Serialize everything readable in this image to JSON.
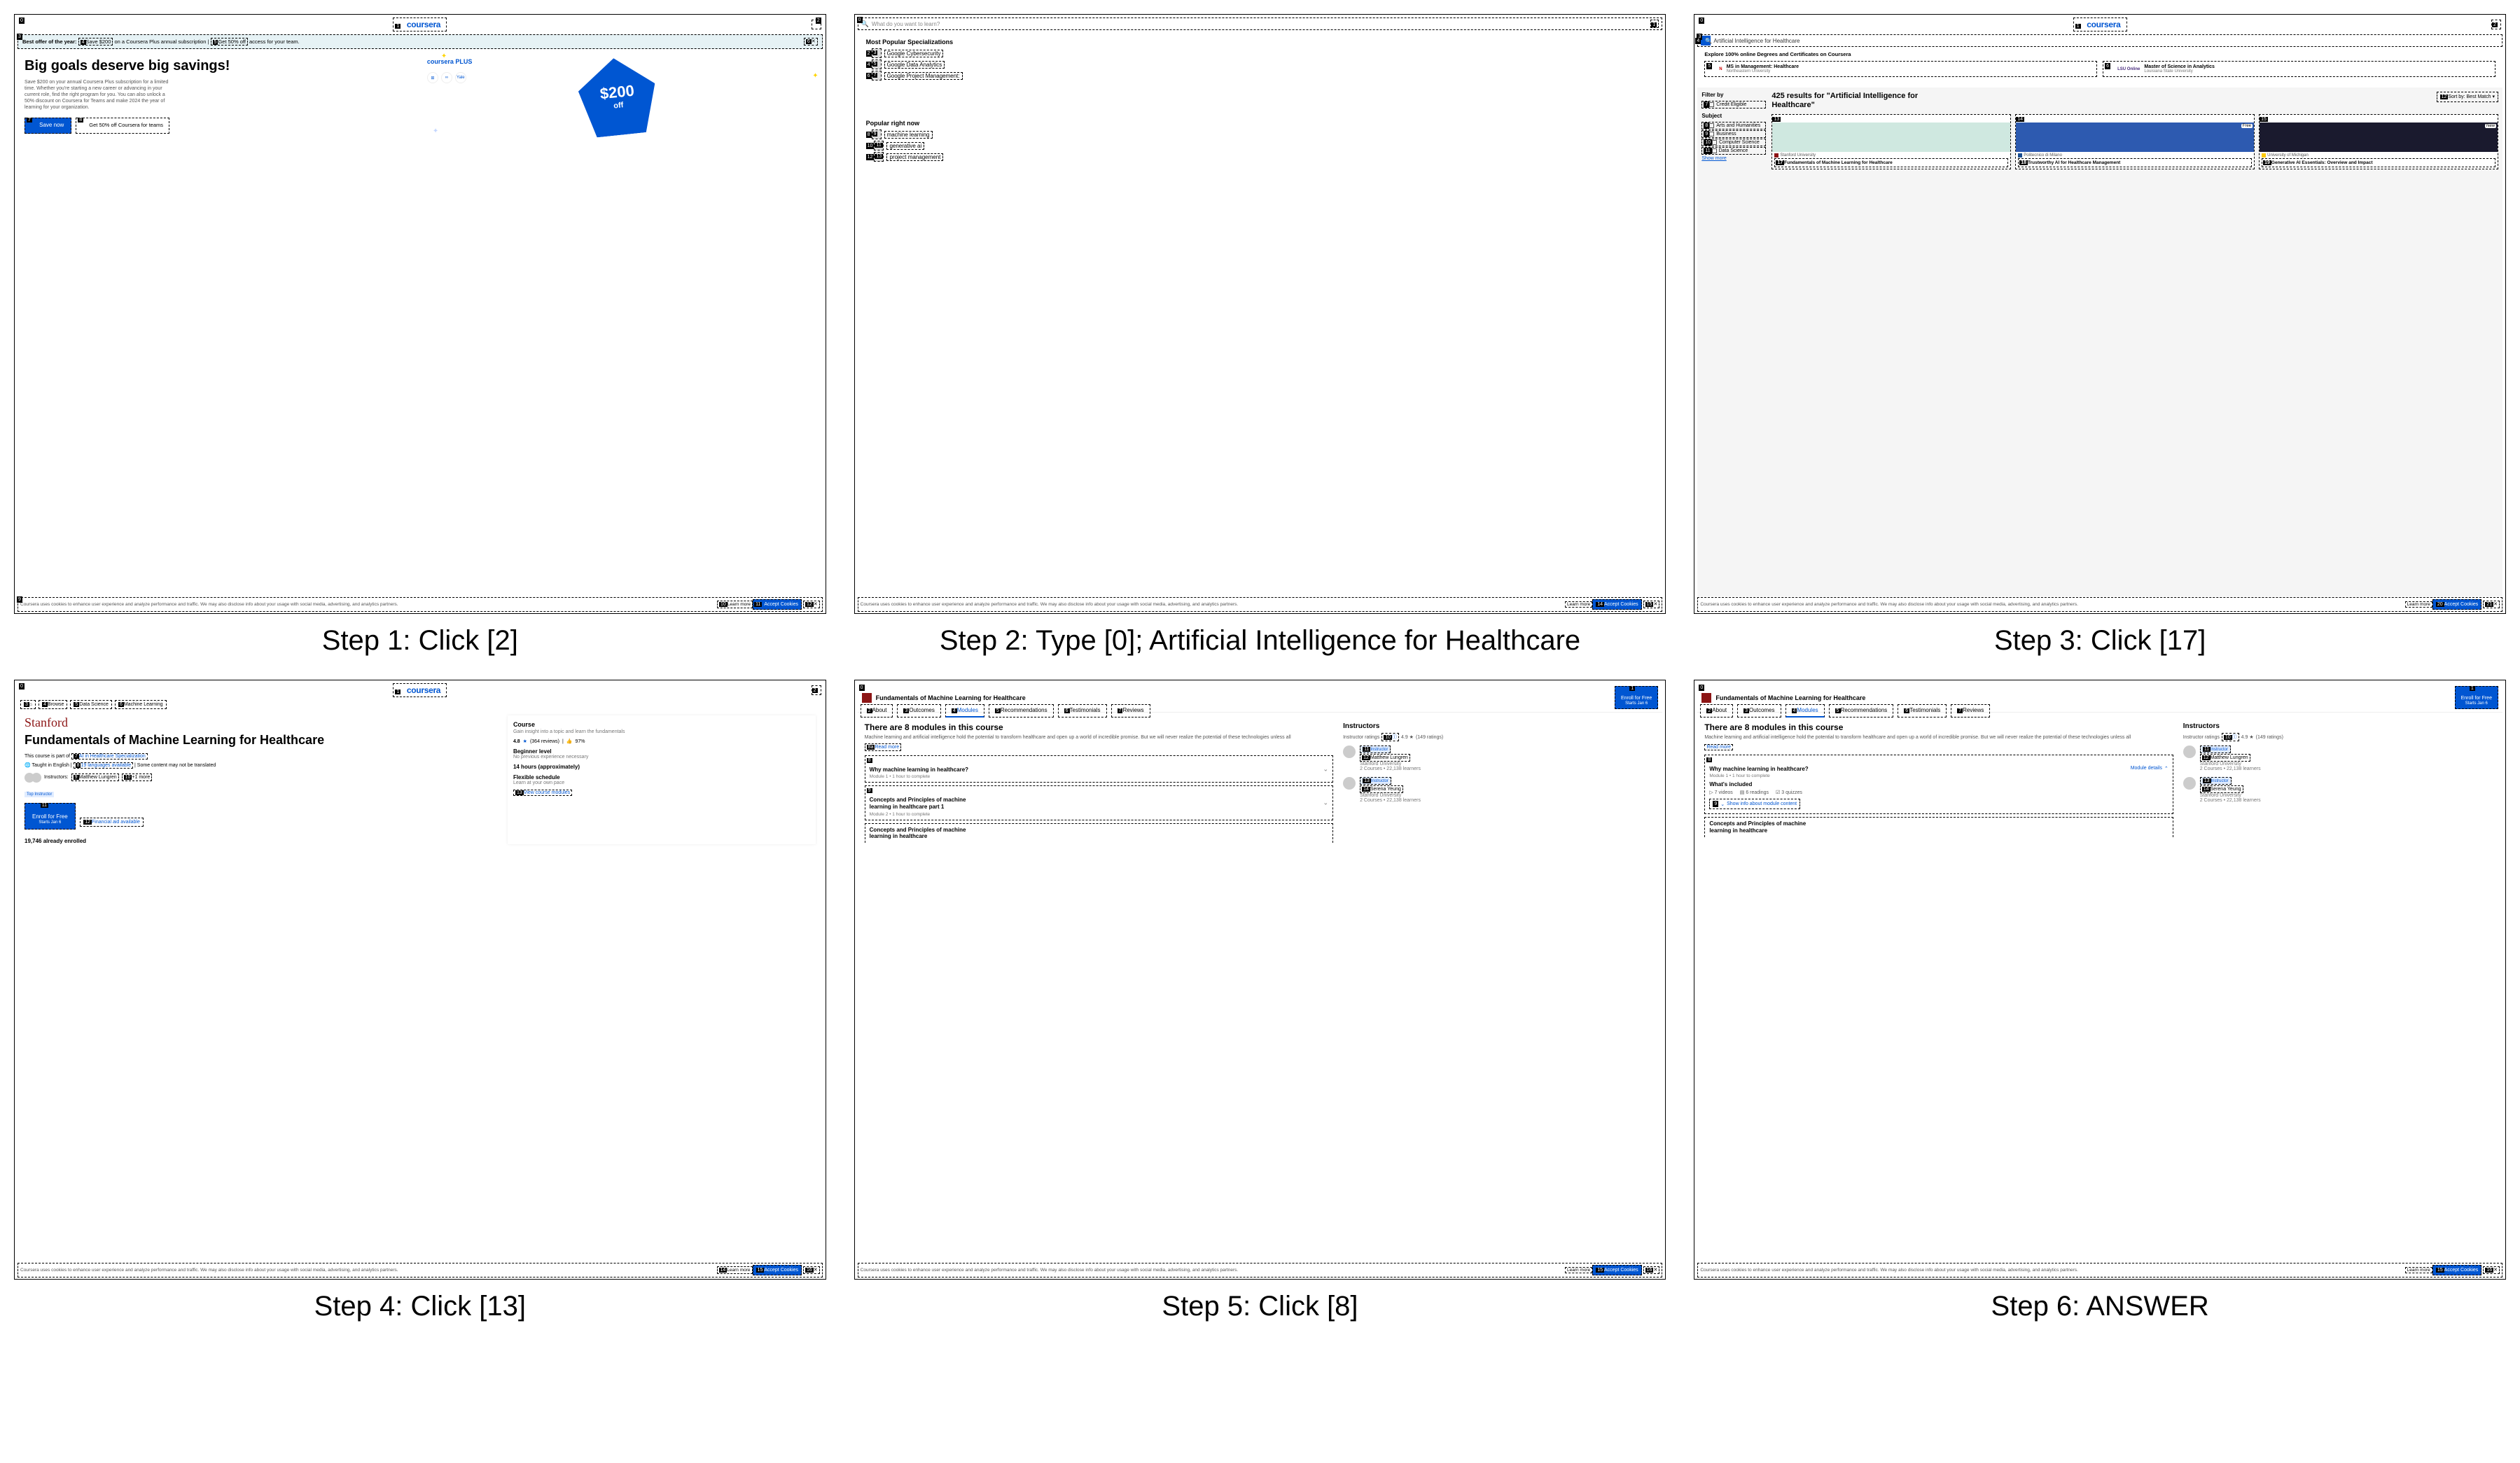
{
  "captions": {
    "s1": "Step 1: Click [2]",
    "s2": "Step 2: Type [0]; Artificial Intelligence for Healthcare",
    "s3": "Step 3: Click [17]",
    "s4": "Step 4: Click [13]",
    "s5": "Step 5: Click [8]",
    "s6": "Step 6: ANSWER"
  },
  "logo": "coursera",
  "cookie": {
    "text": "Coursera uses cookies to enhance user experience and analyze performance and traffic. We may also disclose info about your usage with social media, advertising, and analytics partners.",
    "link": "Learn more",
    "accept": "Accept Cookies",
    "close": "✕"
  },
  "p1": {
    "banner_bold": "Best offer of the year:",
    "banner_save": "Save $200",
    "banner_mid": " on a Coursera Plus annual subscription | ",
    "banner_get": "Get 50% off",
    "banner_end": " access for your team.",
    "banner_close": "✕",
    "title": "Big goals deserve big savings!",
    "desc": "Save $200 on your annual Coursera Plus subscription for a limited time. Whether you're starting a new career or advancing in your current role, find the right program for you. You can also unlock a 50% discount on Coursera for Teams and make 2024 the year of learning for your organization.",
    "btn_primary": "Save now",
    "btn_sec": "Get 50% off Coursera for teams",
    "plus": "coursera PLUS",
    "shape_price": "$200",
    "shape_off": "off"
  },
  "p2": {
    "search_placeholder": "What do you want to learn?",
    "sec1": "Most Popular Specializations",
    "items1": [
      "Google Cybersecurity",
      "Google Data Analytics",
      "Google Project Management:"
    ],
    "sec2": "Popular right now",
    "items2": [
      "machine learning",
      "generative ai",
      "project management"
    ]
  },
  "p3": {
    "search_text": "Artificial Intelligence for Healthcare",
    "deg_header": "Explore 100% online Degrees and Certificates on Coursera",
    "deg1_title": "MS in Management: Healthcare",
    "deg1_sub": "Northeastern University",
    "deg2_title": "Master of Science in Analytics",
    "deg2_sub": "Louisiana State University",
    "deg2_logo": "LSU Online",
    "filter_title": "Filter by",
    "credit": "Credit Eligible",
    "subject": "Subject",
    "subs": [
      "Arts and Humanities",
      "Business",
      "Computer Science",
      "Data Science"
    ],
    "showmore": "Show more",
    "results_title": "425 results for \"Artificial Intelligence for Healthcare\"",
    "sort": "Sort by: Best Match  ▾",
    "cards": [
      {
        "badge": "",
        "uni": "Stanford University",
        "title": "Fundamentals of Machine Learning for Healthcare",
        "color": "#cfe8e0"
      },
      {
        "badge": "Free",
        "uni": "Politecnico di Milano",
        "title": "Trustworthy AI for Healthcare Management",
        "color": "#2d5ab0"
      },
      {
        "badge": "New",
        "uni": "University of Michigan",
        "title": "Generative AI Essentials: Overview and Impact",
        "color": "#1a1a2e"
      }
    ]
  },
  "p4": {
    "crumbs": [
      "⌂",
      "Browse",
      "Data Science",
      "Machine Learning"
    ],
    "uni": "Stanford",
    "title": "Fundamentals of Machine Learning for Healthcare",
    "partof_pre": "This course is part of",
    "partof_link": "AI in Healthcare Specialization",
    "lang_pre": "🌐 Taught in English | ",
    "lang_link": "19 languages available",
    "lang_post": " | Some content may not be translated",
    "inst_pre": "Instructors:",
    "inst_name": "Matthew Lungren",
    "inst_more": "+1 more",
    "top_inst": "Top Instructor",
    "enroll": "Enroll for Free",
    "enroll_sub": "Starts Jan 6",
    "fin": "Financial aid available",
    "enrolled": "19,746 already enrolled",
    "right": {
      "h": "Course",
      "hs": "Gain insight into a topic and learn the fundamentals",
      "rating": "4.8",
      "reviews": "(364 reviews)",
      "like": "97%",
      "lvl": "Beginner level",
      "lvls": "No previous experience necessary",
      "hrs": "14 hours (approximately)",
      "flex": "Flexible schedule",
      "flexs": "Learn at your own pace",
      "view": "View course modules"
    }
  },
  "p56": {
    "header": "Fundamentals of Machine Learning for Healthcare",
    "enroll": "Enroll for Free",
    "enroll_sub": "Starts Jan 6",
    "tabs": [
      "About",
      "Outcomes",
      "Modules",
      "Recommendations",
      "Testimonials",
      "Reviews"
    ],
    "mt": "There are 8 modules in this course",
    "desc": "Machine learning and artificial intelligence hold the potential to transform healthcare and open up a world of incredible promise. But we will never realize the potential of these technologies unless all",
    "readmore": "Read more",
    "mod1_t": "Why machine learning in healthcare?",
    "mod1_s": "Module 1  •  1 hour to complete",
    "mod2_t": "Concepts and Principles of machine learning in healthcare part 1",
    "mod2_s": "Module 2  •  1 hour to complete",
    "mod3_t": "Concepts and Principles of machine learning in healthcare",
    "moddet": "Module details",
    "inc_title": "What's included",
    "inc_videos": "7 videos",
    "inc_readings": "6 readings",
    "inc_quizzes": "3 quizzes",
    "showinfo": "Show info about module content",
    "it": "Instructors",
    "ir_pre": "Instructor ratings",
    "ir_info": "ⓘ",
    "ir_rating": "4.9 ★",
    "ir_count": "(149 ratings)",
    "inst1_badge": "Instructor",
    "inst1_name": "Matthew Lungren",
    "inst1_uni": "Stanford University",
    "inst1_stats": "2 Courses  •  22,138 learners",
    "inst2_badge": "Instructor",
    "inst2_name": "Serena Yeung",
    "inst2_uni": "Stanford University",
    "inst2_stats": "2 Courses  •  22,138 learners"
  }
}
